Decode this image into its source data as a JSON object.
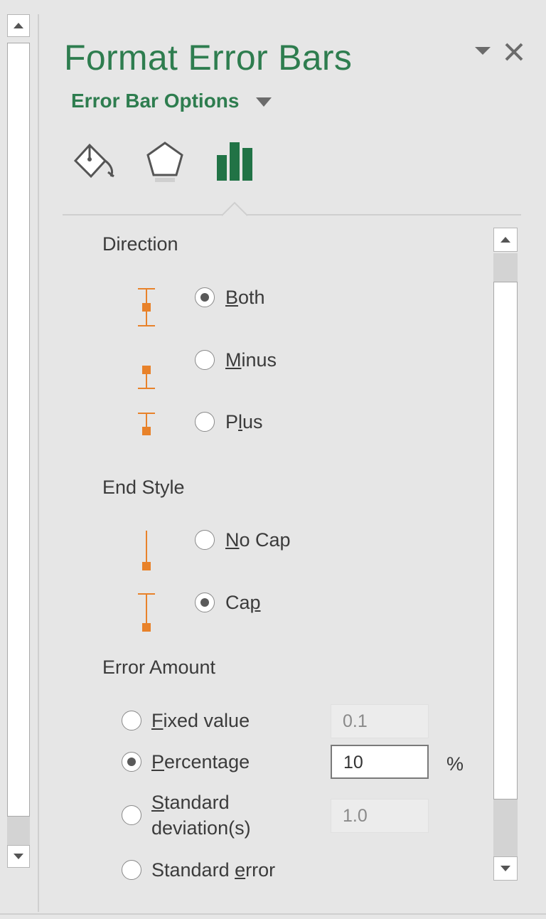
{
  "pane": {
    "title": "Format Error Bars",
    "options_menu_label": "Error Bar Options",
    "tabs": [
      "fill-line-icon",
      "effects-pentagon-icon",
      "error-bar-options-icon"
    ]
  },
  "direction": {
    "title": "Direction",
    "options": [
      {
        "pre": "",
        "mnemonic": "B",
        "post": "oth",
        "selected": true
      },
      {
        "pre": "",
        "mnemonic": "M",
        "post": "inus",
        "selected": false
      },
      {
        "pre": "P",
        "mnemonic": "l",
        "post": "us",
        "selected": false
      }
    ]
  },
  "end_style": {
    "title": "End Style",
    "options": [
      {
        "pre": "",
        "mnemonic": "N",
        "post": "o Cap",
        "selected": false
      },
      {
        "pre": "Ca",
        "mnemonic": "p",
        "post": "",
        "selected": true
      }
    ]
  },
  "error_amount": {
    "title": "Error Amount",
    "fixed": {
      "pre": "",
      "mnemonic": "F",
      "post": "ixed value",
      "value": "0.1",
      "selected": false
    },
    "percentage": {
      "pre": "",
      "mnemonic": "P",
      "post": "ercentage",
      "value": "10",
      "unit": "%",
      "selected": true
    },
    "stddev": {
      "pre": "",
      "mnemonic": "S",
      "post": "tandard",
      "line2": "deviation(s)",
      "value": "1.0",
      "selected": false
    },
    "stderr": {
      "pre": "Standard ",
      "mnemonic": "e",
      "post": "rror",
      "selected": false
    }
  },
  "colors": {
    "accent": "#2e7d4f",
    "orange": "#e8822a"
  }
}
